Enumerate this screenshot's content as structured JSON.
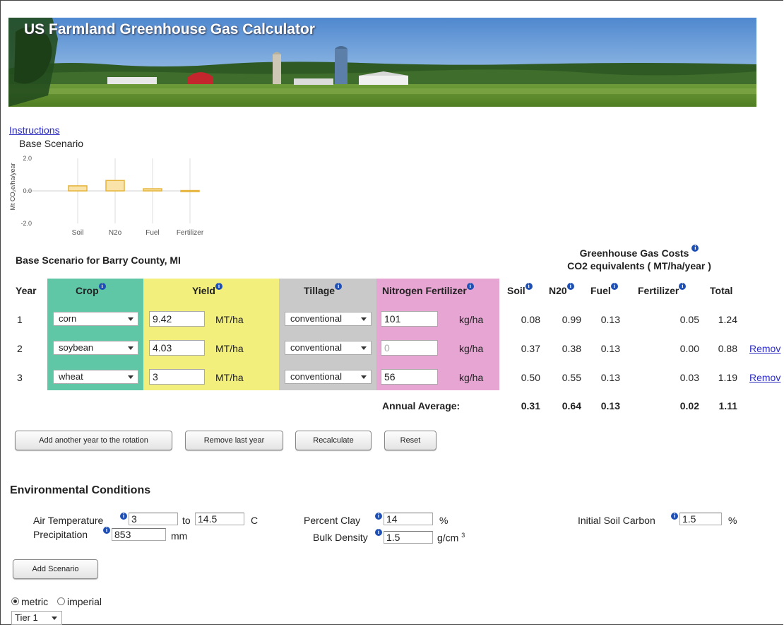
{
  "banner": {
    "title": "US Farmland Greenhouse Gas Calculator"
  },
  "nav": {
    "instructions": "Instructions"
  },
  "mini_chart": {
    "title": "Base Scenario",
    "ylabel": "Mt CO₂e/ha/year",
    "yticks": [
      "2.0",
      "0.0",
      "-2.0"
    ],
    "categories": [
      "Soil",
      "N2o",
      "Fuel",
      "Fertilizer"
    ],
    "values": [
      0.31,
      0.64,
      0.13,
      0.02
    ],
    "ylim": [
      -2.0,
      2.0
    ],
    "bar_fill": "#f9e3a8",
    "bar_stroke": "#e6b43a"
  },
  "scenario": {
    "title": "Base Scenario for Barry County, MI"
  },
  "ghg": {
    "title": "Greenhouse Gas Costs",
    "subtitle": "CO2 equivalents ( MT/ha/year )"
  },
  "table": {
    "headers": {
      "year": "Year",
      "crop": "Crop",
      "yield": "Yield",
      "tillage": "Tillage",
      "nitrogen": "Nitrogen Fertilizer",
      "soil": "Soil",
      "n20": "N20",
      "fuel": "Fuel",
      "fertilizer": "Fertilizer",
      "total": "Total"
    },
    "yield_unit": "MT/ha",
    "nitrogen_unit": "kg/ha",
    "remove_label": "Remov",
    "rows": [
      {
        "year": "1",
        "crop": "corn",
        "yield": "9.42",
        "tillage": "conventional",
        "nitrogen": "101",
        "soil": "0.08",
        "n20": "0.99",
        "fuel": "0.13",
        "fertilizer": "0.05",
        "total": "1.24"
      },
      {
        "year": "2",
        "crop": "soybean",
        "yield": "4.03",
        "tillage": "conventional",
        "nitrogen": "0",
        "soil": "0.37",
        "n20": "0.38",
        "fuel": "0.13",
        "fertilizer": "0.00",
        "total": "0.88"
      },
      {
        "year": "3",
        "crop": "wheat",
        "yield": "3",
        "tillage": "conventional",
        "nitrogen": "56",
        "soil": "0.50",
        "n20": "0.55",
        "fuel": "0.13",
        "fertilizer": "0.03",
        "total": "1.19"
      }
    ],
    "average": {
      "label": "Annual Average:",
      "soil": "0.31",
      "n20": "0.64",
      "fuel": "0.13",
      "fertilizer": "0.02",
      "total": "1.11"
    }
  },
  "buttons": {
    "add_year": "Add another year to the rotation",
    "remove_last": "Remove last year",
    "recalculate": "Recalculate",
    "reset": "Reset",
    "add_scenario": "Add Scenario"
  },
  "env": {
    "title": "Environmental Conditions",
    "air_temp_label": "Air Temperature",
    "air_temp_min": "3",
    "to_label": "to",
    "air_temp_max": "14.5",
    "temp_unit": "C",
    "precip_label": "Precipitation",
    "precip": "853",
    "precip_unit": "mm",
    "clay_label": "Percent Clay",
    "clay": "14",
    "clay_unit": "%",
    "bulk_label": "Bulk Density",
    "bulk": "1.5",
    "bulk_unit": "g/cm",
    "bulk_unit_sup": "3",
    "soil_carbon_label": "Initial Soil Carbon",
    "soil_carbon": "1.5",
    "soil_carbon_unit": "%"
  },
  "units": {
    "metric": "metric",
    "imperial": "imperial",
    "selected": "metric"
  },
  "tier": {
    "selected": "Tier 1"
  }
}
